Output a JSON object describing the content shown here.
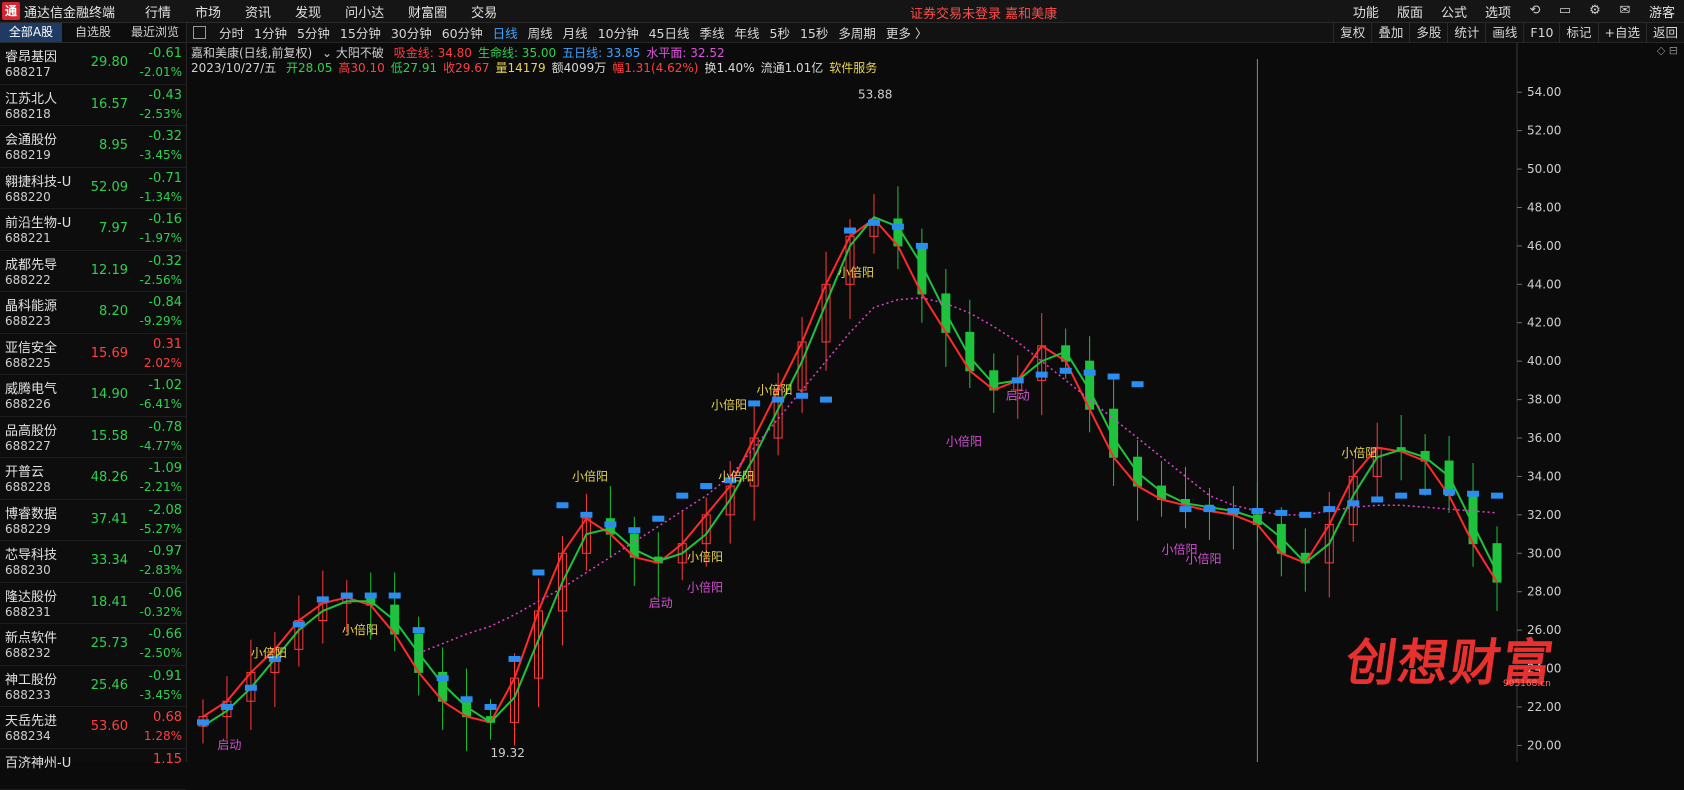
{
  "app": {
    "title": "通达信金融终端",
    "logo_glyph": "通"
  },
  "menu": [
    "行情",
    "市场",
    "资讯",
    "发现",
    "问小达",
    "财富圈",
    "交易"
  ],
  "notice": "证券交易未登录  嘉和美康",
  "right_menu": [
    "功能",
    "版面",
    "公式",
    "选项"
  ],
  "user": "游客",
  "sidebar": {
    "tabs": [
      "全部A股",
      "自选股",
      "最近浏览"
    ],
    "stocks": [
      {
        "name": "睿昂基因",
        "code": "688217",
        "price": "29.80",
        "chg": "-0.61",
        "pct": "-2.01%",
        "dir": "down"
      },
      {
        "name": "江苏北人",
        "code": "688218",
        "price": "16.57",
        "chg": "-0.43",
        "pct": "-2.53%",
        "dir": "down"
      },
      {
        "name": "会通股份",
        "code": "688219",
        "price": "8.95",
        "chg": "-0.32",
        "pct": "-3.45%",
        "dir": "down"
      },
      {
        "name": "翱捷科技-U",
        "code": "688220",
        "price": "52.09",
        "chg": "-0.71",
        "pct": "-1.34%",
        "dir": "down"
      },
      {
        "name": "前沿生物-U",
        "code": "688221",
        "price": "7.97",
        "chg": "-0.16",
        "pct": "-1.97%",
        "dir": "down"
      },
      {
        "name": "成都先导",
        "code": "688222",
        "price": "12.19",
        "chg": "-0.32",
        "pct": "-2.56%",
        "dir": "down"
      },
      {
        "name": "晶科能源",
        "code": "688223",
        "price": "8.20",
        "chg": "-0.84",
        "pct": "-9.29%",
        "dir": "down"
      },
      {
        "name": "亚信安全",
        "code": "688225",
        "price": "15.69",
        "chg": "0.31",
        "pct": "2.02%",
        "dir": "up"
      },
      {
        "name": "威腾电气",
        "code": "688226",
        "price": "14.90",
        "chg": "-1.02",
        "pct": "-6.41%",
        "dir": "down"
      },
      {
        "name": "品高股份",
        "code": "688227",
        "price": "15.58",
        "chg": "-0.78",
        "pct": "-4.77%",
        "dir": "down"
      },
      {
        "name": "开普云",
        "code": "688228",
        "price": "48.26",
        "chg": "-1.09",
        "pct": "-2.21%",
        "dir": "down"
      },
      {
        "name": "博睿数据",
        "code": "688229",
        "price": "37.41",
        "chg": "-2.08",
        "pct": "-5.27%",
        "dir": "down"
      },
      {
        "name": "芯导科技",
        "code": "688230",
        "price": "33.34",
        "chg": "-0.97",
        "pct": "-2.83%",
        "dir": "down"
      },
      {
        "name": "隆达股份",
        "code": "688231",
        "price": "18.41",
        "chg": "-0.06",
        "pct": "-0.32%",
        "dir": "down"
      },
      {
        "name": "新点软件",
        "code": "688232",
        "price": "25.73",
        "chg": "-0.66",
        "pct": "-2.50%",
        "dir": "down"
      },
      {
        "name": "神工股份",
        "code": "688233",
        "price": "25.46",
        "chg": "-0.91",
        "pct": "-3.45%",
        "dir": "down"
      },
      {
        "name": "天岳先进",
        "code": "688234",
        "price": "53.60",
        "chg": "0.68",
        "pct": "1.28%",
        "dir": "up"
      },
      {
        "name": "百济神州-U",
        "code": "",
        "price": "",
        "chg": "1.15",
        "pct": "",
        "dir": "up"
      }
    ]
  },
  "periods": [
    "分时",
    "1分钟",
    "5分钟",
    "15分钟",
    "30分钟",
    "60分钟",
    "日线",
    "周线",
    "月线",
    "10分钟",
    "45日线",
    "季线",
    "年线",
    "5秒",
    "15秒",
    "多周期",
    "更多 〉"
  ],
  "active_period": "日线",
  "tool_buttons": [
    "复权",
    "叠加",
    "多股",
    "统计",
    "画线",
    "F10",
    "标记",
    "+自选",
    "返回"
  ],
  "chart_header": {
    "stock": "嘉和美康(日线,前复权)",
    "indicator": "大阳不破",
    "lines": [
      {
        "label": "吸金线: 34.80",
        "color": "#ff3b3b"
      },
      {
        "label": "生命线: 35.00",
        "color": "#2fd04f"
      },
      {
        "label": "五日线: 33.85",
        "color": "#3fa3ff"
      },
      {
        "label": "水平面: 32.52",
        "color": "#e052e0"
      }
    ],
    "date": "2023/10/27/五",
    "stats": [
      {
        "label": "开28.05",
        "color": "#2fd04f"
      },
      {
        "label": "高30.10",
        "color": "#ff4040"
      },
      {
        "label": "低27.91",
        "color": "#2fd04f"
      },
      {
        "label": "收29.67",
        "color": "#ff4040"
      },
      {
        "label": "量14179",
        "color": "#e8d44d"
      },
      {
        "label": "额4099万",
        "color": "#d8d8d8"
      },
      {
        "label": "幅1.31(4.62%)",
        "color": "#ff4040"
      },
      {
        "label": "换1.40%",
        "color": "#d8d8d8"
      },
      {
        "label": "流通1.01亿",
        "color": "#d8d8d8"
      },
      {
        "label": "软件服务",
        "color": "#e8d44d"
      }
    ]
  },
  "chart_data": {
    "type": "line",
    "y_ticks": [
      54,
      52,
      50,
      48,
      46,
      44,
      42,
      40,
      38,
      36,
      34,
      32,
      30,
      28,
      26,
      24,
      22,
      20
    ],
    "y_tick_labels": [
      "54.00",
      "52.00",
      "50.00",
      "48.00",
      "46.00",
      "44.00",
      "42.00",
      "40.00",
      "38.00",
      "36.00",
      "34.00",
      "32.00",
      "30.00",
      "28.00",
      "26.00",
      "24.00",
      "22.00",
      "20.00"
    ],
    "ylim": [
      19.5,
      55
    ],
    "high_label": "53.88",
    "low_label": "19.32",
    "series": [
      {
        "color": "#ff2a2a",
        "values": [
          21.5,
          22.3,
          23.8,
          25.0,
          26.5,
          27.4,
          27.7,
          27.3,
          25.8,
          23.8,
          22.3,
          21.5,
          21.2,
          23.5,
          27.0,
          30.0,
          31.8,
          31.0,
          29.8,
          29.5,
          30.5,
          32.0,
          33.5,
          36.0,
          38.5,
          41.0,
          44.0,
          46.5,
          47.4,
          46.0,
          43.5,
          41.5,
          39.5,
          38.5,
          39.0,
          40.8,
          40.0,
          37.5,
          35.0,
          33.5,
          32.8,
          32.5,
          32.2,
          32.0,
          31.5,
          30.0,
          29.5,
          31.5,
          34.0,
          35.5,
          35.3,
          34.8,
          33.0,
          30.5,
          28.5
        ]
      },
      {
        "color": "#1ec23c",
        "values": [
          21.0,
          21.8,
          23.0,
          24.5,
          26.0,
          27.0,
          27.5,
          27.5,
          26.5,
          24.8,
          23.2,
          22.0,
          21.2,
          22.5,
          25.5,
          28.5,
          31.0,
          31.3,
          30.2,
          29.6,
          30.0,
          31.0,
          32.8,
          35.0,
          37.5,
          40.0,
          43.0,
          46.0,
          47.5,
          47.0,
          45.0,
          42.5,
          40.2,
          38.8,
          39.0,
          40.0,
          40.5,
          38.5,
          36.0,
          34.2,
          33.2,
          32.6,
          32.4,
          32.2,
          31.8,
          30.8,
          29.5,
          30.5,
          33.0,
          35.0,
          35.4,
          35.0,
          34.0,
          31.5,
          29.0
        ]
      },
      {
        "color": "#e040c8",
        "dashed": true,
        "values": [
          null,
          null,
          null,
          null,
          null,
          null,
          null,
          null,
          null,
          24.8,
          25.3,
          25.8,
          26.2,
          26.8,
          27.5,
          28.2,
          29.0,
          29.8,
          30.6,
          31.4,
          32.2,
          33.0,
          34.0,
          35.5,
          37.0,
          38.5,
          40.0,
          41.5,
          42.8,
          43.2,
          43.3,
          43.0,
          42.5,
          41.8,
          41.0,
          40.0,
          39.0,
          38.0,
          37.0,
          36.0,
          35.0,
          34.0,
          33.0,
          32.5,
          32.2,
          32.0,
          32.0,
          32.2,
          32.4,
          32.5,
          32.5,
          32.4,
          32.3,
          32.2,
          32.1
        ]
      },
      {
        "color": "#2b8df0",
        "bars": true,
        "values": [
          21.2,
          22.0,
          23.0,
          24.5,
          26.3,
          27.6,
          27.8,
          27.8,
          27.8,
          26.0,
          23.5,
          22.4,
          22.0,
          24.5,
          29.0,
          32.5,
          32.0,
          31.5,
          31.2,
          31.8,
          33.0,
          33.5,
          33.8,
          37.8,
          38.0,
          38.2,
          38.0,
          46.8,
          47.2,
          47.0,
          46.0,
          null,
          null,
          null,
          39.0,
          39.3,
          39.5,
          39.4,
          39.2,
          38.8,
          null,
          32.3,
          32.3,
          32.2,
          32.2,
          32.1,
          32.0,
          32.3,
          32.6,
          32.8,
          33.0,
          33.2,
          33.2,
          33.1,
          33.0
        ]
      }
    ],
    "signals": [
      {
        "text": "小倍阳",
        "color": "#e8d44d",
        "x": 2,
        "y": 24.6
      },
      {
        "text": "启动",
        "color": "#d050d0",
        "x": 0.6,
        "y": 19.8
      },
      {
        "text": "小倍阳",
        "color": "#e8d44d",
        "x": 5.8,
        "y": 25.8
      },
      {
        "text": "19.32",
        "color": "#cfcfcf",
        "x": 12,
        "y": 19.4
      },
      {
        "text": "小倍阳",
        "color": "#e8d44d",
        "x": 15.4,
        "y": 33.8
      },
      {
        "text": "小倍阳",
        "color": "#e8d44d",
        "x": 20.2,
        "y": 29.6
      },
      {
        "text": "小倍阳",
        "color": "#d050d0",
        "x": 20.2,
        "y": 28.0
      },
      {
        "text": "启动",
        "color": "#d050d0",
        "x": 18.6,
        "y": 27.2
      },
      {
        "text": "小倍阳",
        "color": "#e8d44d",
        "x": 21.5,
        "y": 33.8
      },
      {
        "text": "小倍阳",
        "color": "#e8d44d",
        "x": 21.2,
        "y": 37.5
      },
      {
        "text": "小倍阳",
        "color": "#e8d44d",
        "x": 23.1,
        "y": 38.3
      },
      {
        "text": "小倍阳",
        "color": "#e8d44d",
        "x": 26.5,
        "y": 44.4
      },
      {
        "text": "启动",
        "color": "#d050d0",
        "x": 33.5,
        "y": 38.0
      },
      {
        "text": "小倍阳",
        "color": "#d050d0",
        "x": 31.0,
        "y": 35.6
      },
      {
        "text": "小倍阳",
        "color": "#d050d0",
        "x": 40.0,
        "y": 30.0
      },
      {
        "text": "小倍阳",
        "color": "#d050d0",
        "x": 41.0,
        "y": 29.5
      },
      {
        "text": "小倍阳",
        "color": "#e8d44d",
        "x": 47.5,
        "y": 35.0
      }
    ]
  },
  "watermark": {
    "text": "创想财富",
    "url": "995168.cn"
  }
}
